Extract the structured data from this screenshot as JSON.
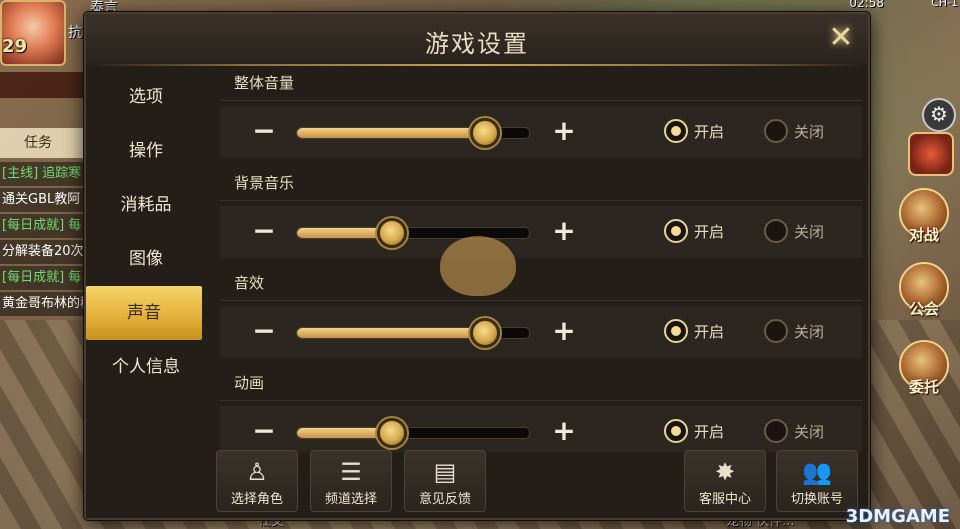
{
  "hud": {
    "level": "29",
    "player_name": "泰言",
    "hud_char": "抗",
    "task_tab": "任务",
    "quests": [
      {
        "text": "[主线] 追踪寒",
        "tag": true
      },
      {
        "text": "通关GBL教阿",
        "tag": false
      },
      {
        "text": "[每日成就] 每",
        "tag": true
      },
      {
        "text": "分解装备20次",
        "tag": false
      },
      {
        "text": "[每日成就] 每日",
        "tag": true
      },
      {
        "text": "黄金哥布林的秘",
        "tag": false
      }
    ],
    "clock": "02:58",
    "channel": "CH-1",
    "side_buttons": [
      "对战",
      "公会",
      "委托"
    ],
    "bottom_left": "社交",
    "bottom_right": "宠物  伙伴..."
  },
  "dialog": {
    "title": "游戏设置",
    "close_symbol": "✕",
    "tabs": [
      "选项",
      "操作",
      "消耗品",
      "图像",
      "声音",
      "个人信息"
    ],
    "active_tab": "声音",
    "minus_symbol": "−",
    "plus_symbol": "+",
    "sections": [
      {
        "label": "整体音量",
        "level": 0.81,
        "on_label": "开启",
        "off_label": "关闭",
        "enabled": true
      },
      {
        "label": "背景音乐",
        "level": 0.41,
        "on_label": "开启",
        "off_label": "关闭",
        "enabled": true
      },
      {
        "label": "音效",
        "level": 0.81,
        "on_label": "开启",
        "off_label": "关闭",
        "enabled": true
      },
      {
        "label": "动画",
        "level": 0.41,
        "on_label": "开启",
        "off_label": "关闭",
        "enabled": true
      }
    ],
    "actions": [
      {
        "label": "选择角色",
        "icon": "person-icon"
      },
      {
        "label": "频道选择",
        "icon": "list-icon"
      },
      {
        "label": "意见反馈",
        "icon": "clipboard-icon"
      },
      {
        "label": "客服中心",
        "icon": "support-icon"
      },
      {
        "label": "切换账号",
        "icon": "switch-account-icon"
      }
    ]
  },
  "watermark": "3DMGAME",
  "colors": {
    "accent": "#e3b23c",
    "panel": "#241e19",
    "slider_fill": "#d4a84c"
  }
}
